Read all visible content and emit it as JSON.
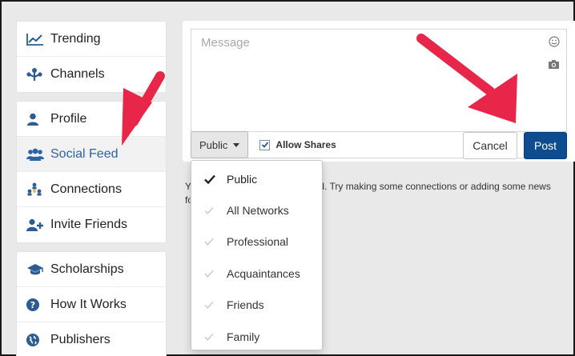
{
  "sidebar": {
    "groups": [
      [
        {
          "label": "Trending",
          "icon": "trending-icon"
        },
        {
          "label": "Channels",
          "icon": "channels-icon"
        }
      ],
      [
        {
          "label": "Profile",
          "icon": "profile-icon"
        },
        {
          "label": "Social Feed",
          "icon": "social-feed-icon",
          "active": true
        },
        {
          "label": "Connections",
          "icon": "connections-icon"
        },
        {
          "label": "Invite Friends",
          "icon": "invite-friends-icon"
        }
      ],
      [
        {
          "label": "Scholarships",
          "icon": "graduation-cap-icon"
        },
        {
          "label": "How It Works",
          "icon": "question-icon"
        },
        {
          "label": "Publishers",
          "icon": "globe-icon"
        }
      ]
    ]
  },
  "composer": {
    "message_placeholder": "Message",
    "privacy_label": "Public",
    "allow_shares_label": "Allow Shares",
    "allow_shares_checked": true,
    "cancel_label": "Cancel",
    "post_label": "Post"
  },
  "privacy_menu": {
    "items": [
      "Public",
      "All Networks",
      "Professional",
      "Acquaintances",
      "Friends",
      "Family"
    ],
    "selected": "Public"
  },
  "feed": {
    "empty_line1_left": "Yo",
    "empty_line1_right": "eed. Try making some connections or adding some news",
    "empty_line2_left": "fo"
  },
  "colors": {
    "accent": "#0d4c8f",
    "link": "#2a64a8",
    "arrow": "#e8264a"
  }
}
